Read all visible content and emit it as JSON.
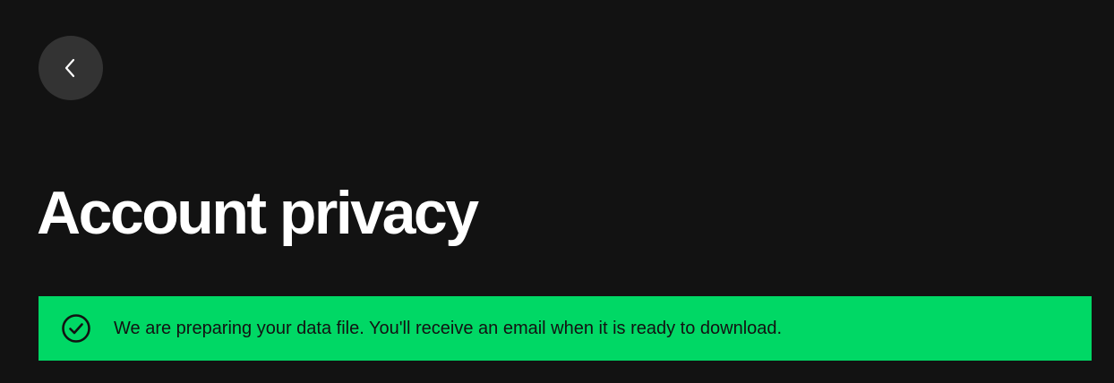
{
  "header": {
    "back_icon": "chevron-left-icon"
  },
  "title": "Account privacy",
  "banner": {
    "icon": "check-circle-icon",
    "message": "We are preparing your data file. You'll receive an email when it is ready to download.",
    "color": "#00d865"
  },
  "colors": {
    "background": "#121212",
    "back_button": "#333333",
    "title": "#ffffff",
    "banner_text": "#121212"
  }
}
